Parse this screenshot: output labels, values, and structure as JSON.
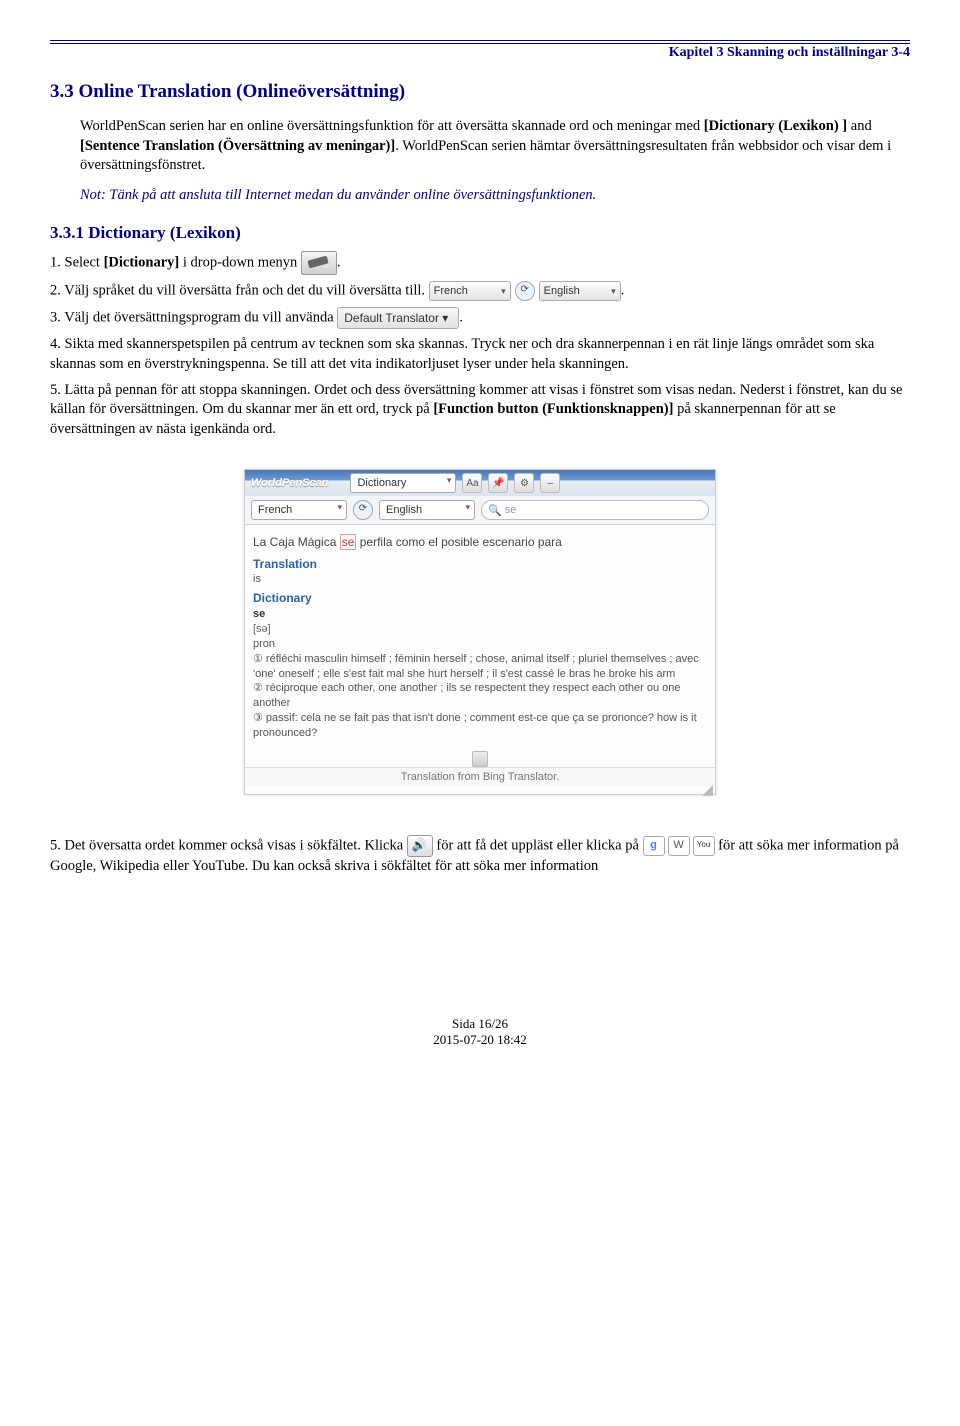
{
  "header": {
    "chapter": "Kapitel 3 Skanning och inställningar 3-4"
  },
  "section": {
    "title": "3.3 Online Translation (Onlineöversättning)",
    "intro_1": "WorldPenScan serien har en online översättningsfunktion för att översätta skannade ord och meningar med ",
    "intro_bold_1": "[Dictionary (Lexikon) ]",
    "intro_mid": " and ",
    "intro_bold_2": "[Sentence Translation (Översättning av meningar)]",
    "intro_2": ". WorldPenScan serien hämtar översättningsresultaten från webbsidor och visar dem i översättningsfönstret.",
    "note": "Not: Tänk på att ansluta till Internet medan du använder online översättningsfunktionen."
  },
  "subsection": {
    "title": "3.3.1 Dictionary (Lexikon)",
    "step1_a": "1. Select ",
    "step1_b": "[Dictionary]",
    "step1_c": " i drop-down menyn",
    "step2": "2. Välj språket du vill översätta från och det du vill översätta till. ",
    "step3": "3. Välj det översättningsprogram du vill använda ",
    "step4": "4. Sikta med skannerspetspilen på centrum av tecknen som ska skannas. Tryck ner och dra skannerpennan i en rät linje längs området som ska skannas som en överstrykningspenna. Se till att det vita indikatorljuset lyser under hela skanningen.",
    "step5_a": "5. Lätta på pennan för att stoppa skanningen. Ordet och dess översättning kommer att visas i fönstret som visas nedan. Nederst i fönstret, kan du se källan för översättningen. Om du skannar mer än ett ord, tryck på ",
    "step5_b": "[Function button (Funktionsknappen)]",
    "step5_c": " på skannerpennan för att se översättningen av nästa igenkända ord.",
    "lang_from": "French",
    "lang_to": "English",
    "translator_default": "Default Translator ▾"
  },
  "app_window": {
    "brand": "WorldPenScan",
    "mode": "Dictionary",
    "aa": "Aa",
    "lang_from": "French",
    "lang_to": "English",
    "search_prefix": "se",
    "scan_sentence_a": "La Caja Mágica ",
    "scan_sentence_hl": "se",
    "scan_sentence_b": " perfila como el posible escenario para",
    "translation_label": "Translation",
    "translation_value": "is",
    "dictionary_label": "Dictionary",
    "dict_word": "se",
    "dict_ipa": "[sə]",
    "dict_pos": "pron",
    "dict_line1": "① réfléchi masculin himself ; féminin herself ; chose, animal itself ; pluriel themselves ; avec 'one' oneself ; elle s'est fait mal she hurt herself ; il s'est cassé le bras he broke his arm",
    "dict_line2": "② réciproque each other, one another ; ils se respectent they respect each other ou one another",
    "dict_line3": "③ passif: cela ne se fait pas that isn't done ; comment est-ce que ça se prononce? how is it pronounced?",
    "footer": "Translation from Bing Translator."
  },
  "after": {
    "line_a": "5. Det översatta ordet kommer också visas i sökfältet. Klicka ",
    "line_b": "för att få det uppläst eller klicka på ",
    "line_c": " för att söka mer information på Google, Wikipedia eller YouTube. Du kan också skriva i sökfältet för att söka mer information"
  },
  "footer": {
    "page": "Sida 16/26",
    "date": "2015-07-20 18:42"
  }
}
